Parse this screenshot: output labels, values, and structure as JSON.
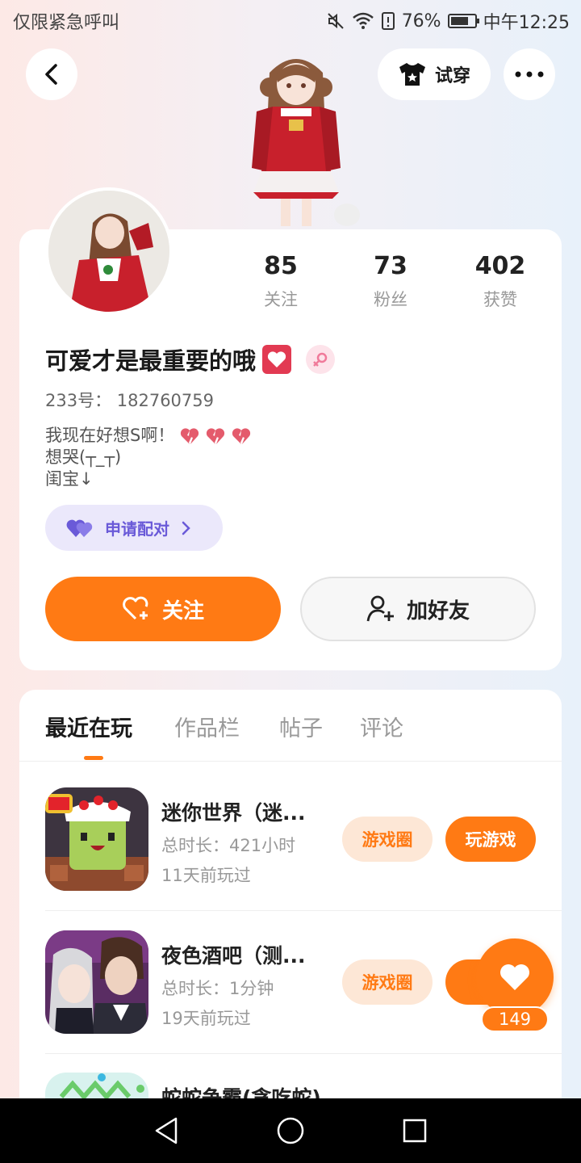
{
  "status_bar": {
    "left_text": "仅限紧急呼叫",
    "battery": "76%",
    "battery_level": 0.76,
    "time": "中午12:25"
  },
  "header": {
    "try_on_label": "试穿"
  },
  "profile": {
    "stats": [
      {
        "value": "85",
        "label": "关注"
      },
      {
        "value": "73",
        "label": "粉丝"
      },
      {
        "value": "402",
        "label": "获赞"
      }
    ],
    "username": "可爱才是最重要的哦",
    "id_line": "233号： 182760759",
    "bio": [
      "我现在好想S啊！",
      "想哭(┬_┬)",
      "闺宝↓"
    ],
    "pair_label": "申请配对",
    "follow_label": "关注",
    "add_friend_label": "加好友"
  },
  "tabs": [
    "最近在玩",
    "作品栏",
    "帖子",
    "评论"
  ],
  "games": [
    {
      "name": "迷你世界（迷...",
      "duration": "总时长：421小时",
      "last_played": "11天前玩过",
      "circle_label": "游戏圈",
      "play_label": "玩游戏"
    },
    {
      "name": "夜色酒吧（测...",
      "duration": "总时长：1分钟",
      "last_played": "19天前玩过",
      "circle_label": "游戏圈",
      "play_label": "玩"
    },
    {
      "name": "蛇蛇争霸(贪吃蛇)"
    }
  ],
  "floating_like": {
    "count": "149"
  },
  "colors": {
    "accent": "#ff7a14",
    "pair_purple": "#6a5ad8"
  }
}
